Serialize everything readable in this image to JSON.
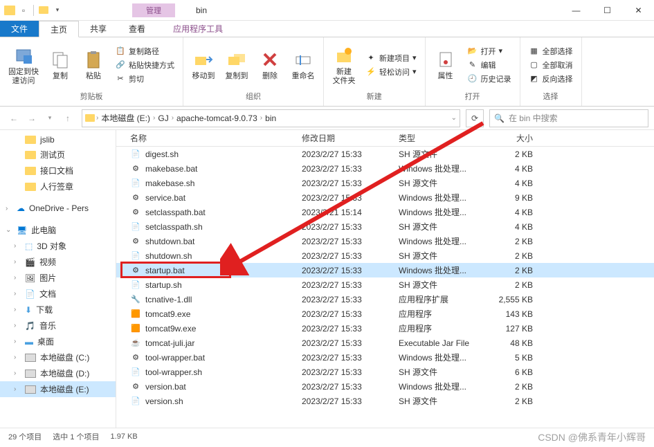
{
  "title": {
    "manage": "管理",
    "folder_name": "bin",
    "app_tools": "应用程序工具"
  },
  "tabs": {
    "file": "文件",
    "home": "主页",
    "share": "共享",
    "view": "查看"
  },
  "ribbon": {
    "pin": "固定到快\n速访问",
    "copy": "复制",
    "paste": "粘贴",
    "copy_path": "复制路径",
    "paste_shortcut": "粘贴快捷方式",
    "cut": "剪切",
    "clipboard_label": "剪贴板",
    "move_to": "移动到",
    "copy_to": "复制到",
    "delete": "删除",
    "rename": "重命名",
    "organize_label": "组织",
    "new_folder": "新建\n文件夹",
    "new_item": "新建项目",
    "easy_access": "轻松访问",
    "new_label": "新建",
    "properties": "属性",
    "open": "打开",
    "edit": "编辑",
    "history": "历史记录",
    "open_label": "打开",
    "select_all": "全部选择",
    "select_none": "全部取消",
    "invert_selection": "反向选择",
    "select_label": "选择"
  },
  "breadcrumb": {
    "drive": "本地磁盘 (E:)",
    "p1": "GJ",
    "p2": "apache-tomcat-9.0.73",
    "p3": "bin"
  },
  "search": {
    "placeholder": "在 bin 中搜索"
  },
  "nav": {
    "jslib": "jslib",
    "test_page": "测试页",
    "api_doc": "接口文档",
    "renxing": "人行签章",
    "onedrive": "OneDrive - Pers",
    "this_pc": "此电脑",
    "objects_3d": "3D 对象",
    "videos": "视频",
    "pictures": "图片",
    "documents": "文档",
    "downloads": "下载",
    "music": "音乐",
    "desktop": "桌面",
    "drive_c": "本地磁盘 (C:)",
    "drive_d": "本地磁盘 (D:)",
    "drive_e": "本地磁盘 (E:)"
  },
  "columns": {
    "name": "名称",
    "date": "修改日期",
    "type": "类型",
    "size": "大小"
  },
  "files": [
    {
      "icon": "sh",
      "name": "digest.sh",
      "date": "2023/2/27 15:33",
      "type": "SH 源文件",
      "size": "2 KB"
    },
    {
      "icon": "bat",
      "name": "makebase.bat",
      "date": "2023/2/27 15:33",
      "type": "Windows 批处理...",
      "size": "4 KB"
    },
    {
      "icon": "sh",
      "name": "makebase.sh",
      "date": "2023/2/27 15:33",
      "type": "SH 源文件",
      "size": "4 KB"
    },
    {
      "icon": "bat",
      "name": "service.bat",
      "date": "2023/2/27 15:33",
      "type": "Windows 批处理...",
      "size": "9 KB"
    },
    {
      "icon": "bat",
      "name": "setclasspath.bat",
      "date": "2023/3/21 15:14",
      "type": "Windows 批处理...",
      "size": "4 KB"
    },
    {
      "icon": "sh",
      "name": "setclasspath.sh",
      "date": "2023/2/27 15:33",
      "type": "SH 源文件",
      "size": "4 KB"
    },
    {
      "icon": "bat",
      "name": "shutdown.bat",
      "date": "2023/2/27 15:33",
      "type": "Windows 批处理...",
      "size": "2 KB"
    },
    {
      "icon": "sh",
      "name": "shutdown.sh",
      "date": "2023/2/27 15:33",
      "type": "SH 源文件",
      "size": "2 KB"
    },
    {
      "icon": "bat",
      "name": "startup.bat",
      "date": "2023/2/27 15:33",
      "type": "Windows 批处理...",
      "size": "2 KB",
      "selected": true
    },
    {
      "icon": "sh",
      "name": "startup.sh",
      "date": "2023/2/27 15:33",
      "type": "SH 源文件",
      "size": "2 KB"
    },
    {
      "icon": "dll",
      "name": "tcnative-1.dll",
      "date": "2023/2/27 15:33",
      "type": "应用程序扩展",
      "size": "2,555 KB"
    },
    {
      "icon": "exe",
      "name": "tomcat9.exe",
      "date": "2023/2/27 15:33",
      "type": "应用程序",
      "size": "143 KB"
    },
    {
      "icon": "exe",
      "name": "tomcat9w.exe",
      "date": "2023/2/27 15:33",
      "type": "应用程序",
      "size": "127 KB"
    },
    {
      "icon": "jar",
      "name": "tomcat-juli.jar",
      "date": "2023/2/27 15:33",
      "type": "Executable Jar File",
      "size": "48 KB"
    },
    {
      "icon": "bat",
      "name": "tool-wrapper.bat",
      "date": "2023/2/27 15:33",
      "type": "Windows 批处理...",
      "size": "5 KB"
    },
    {
      "icon": "sh",
      "name": "tool-wrapper.sh",
      "date": "2023/2/27 15:33",
      "type": "SH 源文件",
      "size": "6 KB"
    },
    {
      "icon": "bat",
      "name": "version.bat",
      "date": "2023/2/27 15:33",
      "type": "Windows 批处理...",
      "size": "2 KB"
    },
    {
      "icon": "sh",
      "name": "version.sh",
      "date": "2023/2/27 15:33",
      "type": "SH 源文件",
      "size": "2 KB"
    }
  ],
  "status": {
    "items": "29 个项目",
    "selected": "选中 1 个项目",
    "size": "1.97 KB"
  },
  "watermark": "CSDN @佛系青年小辉哥"
}
